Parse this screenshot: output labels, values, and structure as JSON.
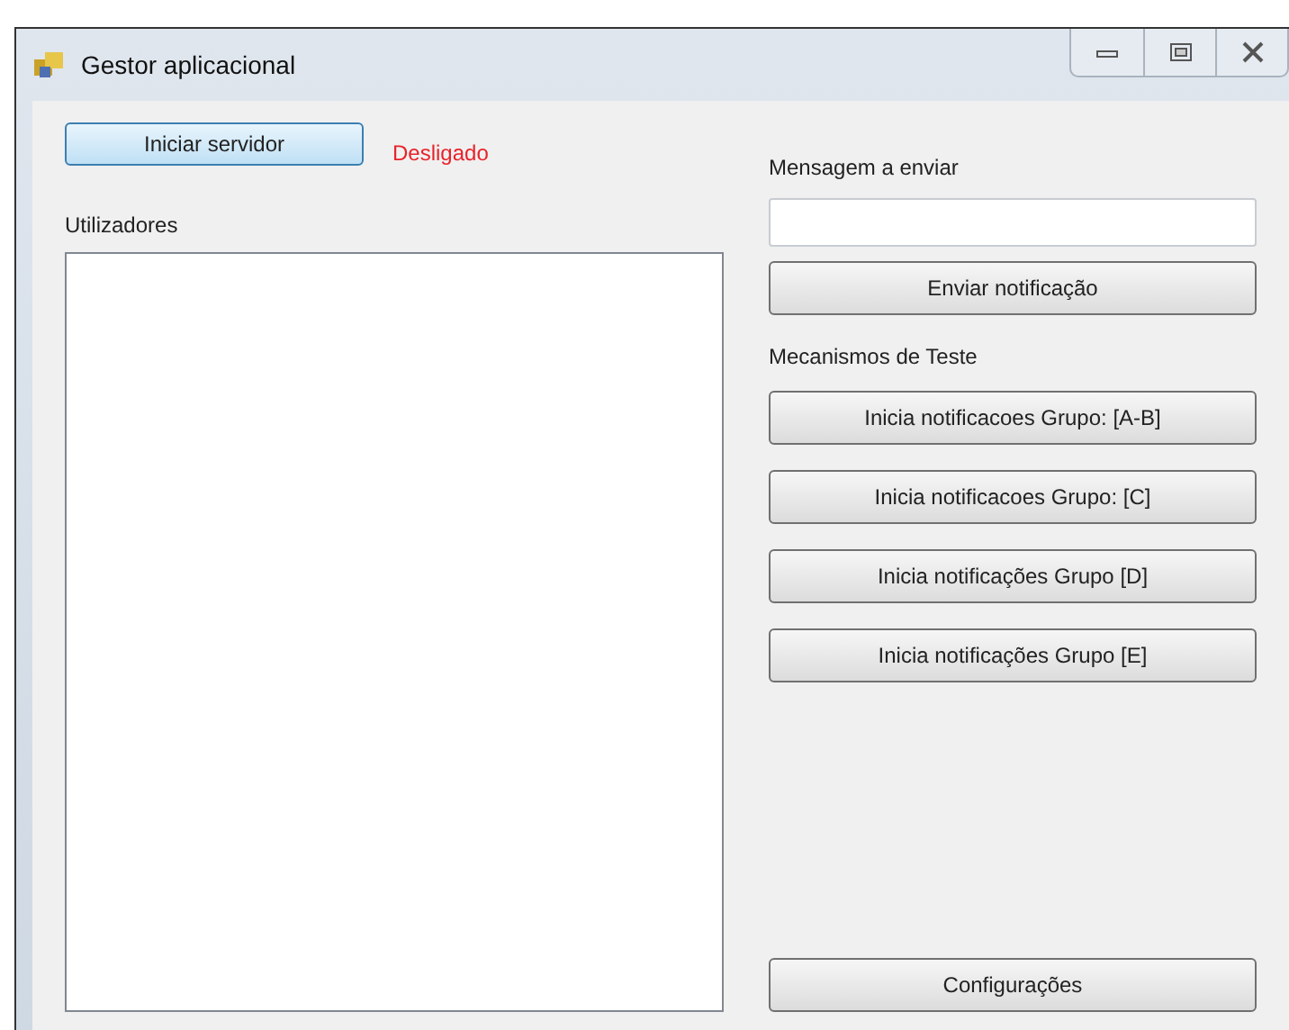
{
  "window": {
    "title": "Gestor aplicacional"
  },
  "server": {
    "button": "Iniciar servidor",
    "status": "Desligado",
    "running": false
  },
  "users": {
    "label": "Utilizadores"
  },
  "message": {
    "label": "Mensagem a enviar",
    "send_button": "Enviar notificação"
  },
  "test": {
    "label": "Mecanismos de Teste",
    "buttons": [
      "Inicia notificacoes Grupo: [A-B]",
      "Inicia notificacoes Grupo: [C]",
      "Inicia notificações Grupo [D]",
      "Inicia notificações Grupo [E]"
    ]
  },
  "settings_button": "Configurações"
}
